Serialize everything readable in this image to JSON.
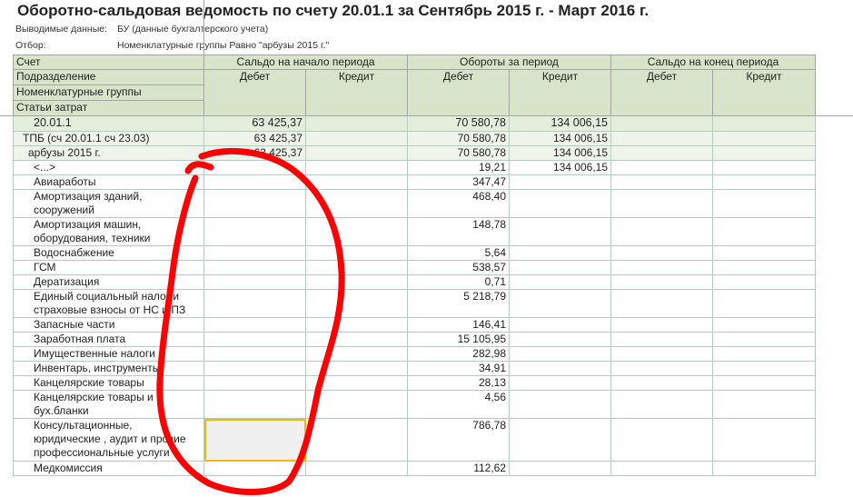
{
  "title": "Оборотно-сальдовая ведомость по счету 20.01.1 за Сентябрь 2015 г. - Март 2016 г.",
  "meta": [
    {
      "label": "Выводимые данные:",
      "value": "БУ (данные бухгалтерского учета)"
    },
    {
      "label": "Отбор:",
      "value": "Номенклатурные группы Равно \"арбузы 2015 г.\""
    }
  ],
  "header": {
    "rows": [
      "Счет",
      "Подразделение",
      "Номенклатурные группы",
      "Статьи затрат"
    ],
    "groups": [
      "Сальдо на начало периода",
      "Обороты за период",
      "Сальдо на конец периода"
    ],
    "debit": "Дебет",
    "credit": "Кредит"
  },
  "rows": [
    {
      "name": "20.01.1",
      "sd": "63 425,37",
      "sc": "",
      "od": "70 580,78",
      "oc": "134 006,15",
      "ed": "",
      "ec": ""
    },
    {
      "name": "ТПБ (сч 20.01.1 сч 23.03)",
      "sd": "63 425,37",
      "sc": "",
      "od": "70 580,78",
      "oc": "134 006,15",
      "ed": "",
      "ec": ""
    },
    {
      "name": "арбузы 2015 г.",
      "sd": "63 425,37",
      "sc": "",
      "od": "70 580,78",
      "oc": "134 006,15",
      "ed": "",
      "ec": ""
    },
    {
      "name": "<...>",
      "sd": "",
      "sc": "",
      "od": "19,21",
      "oc": "134 006,15",
      "ed": "",
      "ec": ""
    },
    {
      "name": "Авиаработы",
      "od": "347,47"
    },
    {
      "name": "Амортизация зданий, сооружений",
      "od": "468,40"
    },
    {
      "name": "Амортизация машин, оборудования, техники",
      "od": "148,78"
    },
    {
      "name": "Водоснабжение",
      "od": "5,64"
    },
    {
      "name": "ГСМ",
      "od": "538,57"
    },
    {
      "name": "Дератизация",
      "od": "0,71"
    },
    {
      "name": "Единый социальный налог и страховые взносы от НС и ПЗ",
      "od": "5 218,79"
    },
    {
      "name": "Запасные части",
      "od": "146,41"
    },
    {
      "name": "Заработная плата",
      "od": "15 105,95"
    },
    {
      "name": "Имущественные налоги",
      "od": "282,98"
    },
    {
      "name": "Инвентарь, инструменты",
      "od": "34,91"
    },
    {
      "name": "Канцелярские товары",
      "od": "28,13"
    },
    {
      "name": "Канцелярские товары и бух.бланки",
      "od": "4,56"
    },
    {
      "name": "Консультационные, юридические , аудит и прочие профессиональные услуги",
      "od": "786,78"
    },
    {
      "name": "Медкомиссия",
      "od": "112,62"
    }
  ],
  "annotation_color": "#ff0000"
}
